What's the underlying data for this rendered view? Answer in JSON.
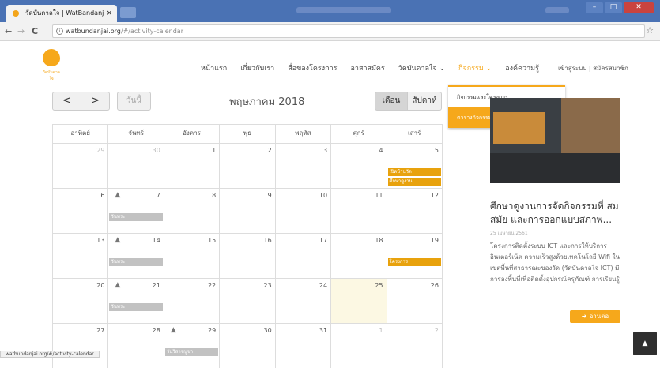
{
  "browser": {
    "tab_title": "วัดบันดาลใจ | WatBandanj",
    "tab_close": "×",
    "url_host": "watbundanjai.org",
    "url_path": "/#/activity-calendar",
    "back": "←",
    "forward": "→",
    "reload": "C",
    "star": "☆",
    "window_controls": [
      "–",
      "□",
      "✕"
    ]
  },
  "site": {
    "logo_caption": "วัดบันดาลใจ",
    "nav": [
      "หน้าแรก",
      "เกี่ยวกับเรา",
      "สื่อของโครงการ",
      "อาสาสมัคร",
      "วัดบันดาลใจ ⌄",
      "กิจกรรม ⌄",
      "องค์ความรู้"
    ],
    "login": "เข้าสู่ระบบ | สมัครสมาชิก",
    "dropdown": [
      "กิจกรรมและโครงการ",
      "ตารางกิจกรรม"
    ]
  },
  "calendar": {
    "prev": "<",
    "next": ">",
    "today": "วันนี้",
    "title": "พฤษภาคม 2018",
    "view_month": "เดือน",
    "view_week": "สัปดาห์",
    "weekdays": [
      "อาทิตย์",
      "จันทร์",
      "อังคาร",
      "พุธ",
      "พฤหัส",
      "ศุกร์",
      "เสาร์"
    ],
    "weeks": [
      [
        {
          "d": "29",
          "m": true
        },
        {
          "d": "30",
          "m": true
        },
        {
          "d": "1"
        },
        {
          "d": "2"
        },
        {
          "d": "3"
        },
        {
          "d": "4"
        },
        {
          "d": "5",
          "ev": [
            {
              "t": "เปิดบ้านวัด",
              "c": "orange"
            },
            {
              "t": "ศึกษาดูงาน",
              "c": "orange"
            }
          ]
        }
      ],
      [
        {
          "d": "6"
        },
        {
          "d": "7",
          "pin": true,
          "ev": [
            {
              "t": "วันพระ",
              "c": "gray"
            }
          ]
        },
        {
          "d": "8"
        },
        {
          "d": "9"
        },
        {
          "d": "10"
        },
        {
          "d": "11"
        },
        {
          "d": "12"
        }
      ],
      [
        {
          "d": "13"
        },
        {
          "d": "14",
          "pin": true,
          "ev": [
            {
              "t": "วันพระ",
              "c": "gray"
            }
          ]
        },
        {
          "d": "15"
        },
        {
          "d": "16"
        },
        {
          "d": "17"
        },
        {
          "d": "18"
        },
        {
          "d": "19",
          "ev": [
            {
              "t": "โครงการ",
              "c": "orange"
            }
          ]
        }
      ],
      [
        {
          "d": "20"
        },
        {
          "d": "21",
          "pin": true,
          "ev": [
            {
              "t": "วันพระ",
              "c": "gray"
            }
          ]
        },
        {
          "d": "22"
        },
        {
          "d": "23"
        },
        {
          "d": "24"
        },
        {
          "d": "25",
          "today": true
        },
        {
          "d": "26"
        }
      ],
      [
        {
          "d": "27"
        },
        {
          "d": "28"
        },
        {
          "d": "29",
          "pin": true,
          "ev": [
            {
              "t": "วันวิสาขบูชา",
              "c": "gray"
            }
          ]
        },
        {
          "d": "30"
        },
        {
          "d": "31"
        },
        {
          "d": "1",
          "m": true
        },
        {
          "d": "2",
          "m": true
        }
      ]
    ]
  },
  "article": {
    "title": "ศึกษาดูงานการจัดกิจกรรมที่ สมสมัย และการออกแบบสภาพ...",
    "date": "25 เมษายน 2561",
    "body": "โครงการติดตั้งระบบ ICT และการให้บริการอินเตอร์เน็ต ความเร็วสูงด้วยเทคโนโลยี Wifi ในเขตพื้นที่สาธารณะของวัด (วัดบันดาลใจ ICT) มีการลงพื้นที่เพื่อติดตั้งอุปกรณ์ครุภัณฑ์ การเรียนรู้",
    "read_more": "อ่านต่อ"
  },
  "back_to_top": "▲",
  "status_url": "watbundanjai.org/#/activity-calendar",
  "colors": {
    "accent": "#f6a81b",
    "event_orange": "#e8a20d",
    "event_gray": "#c2c2c2",
    "chrome_blue": "#4a72b4"
  }
}
